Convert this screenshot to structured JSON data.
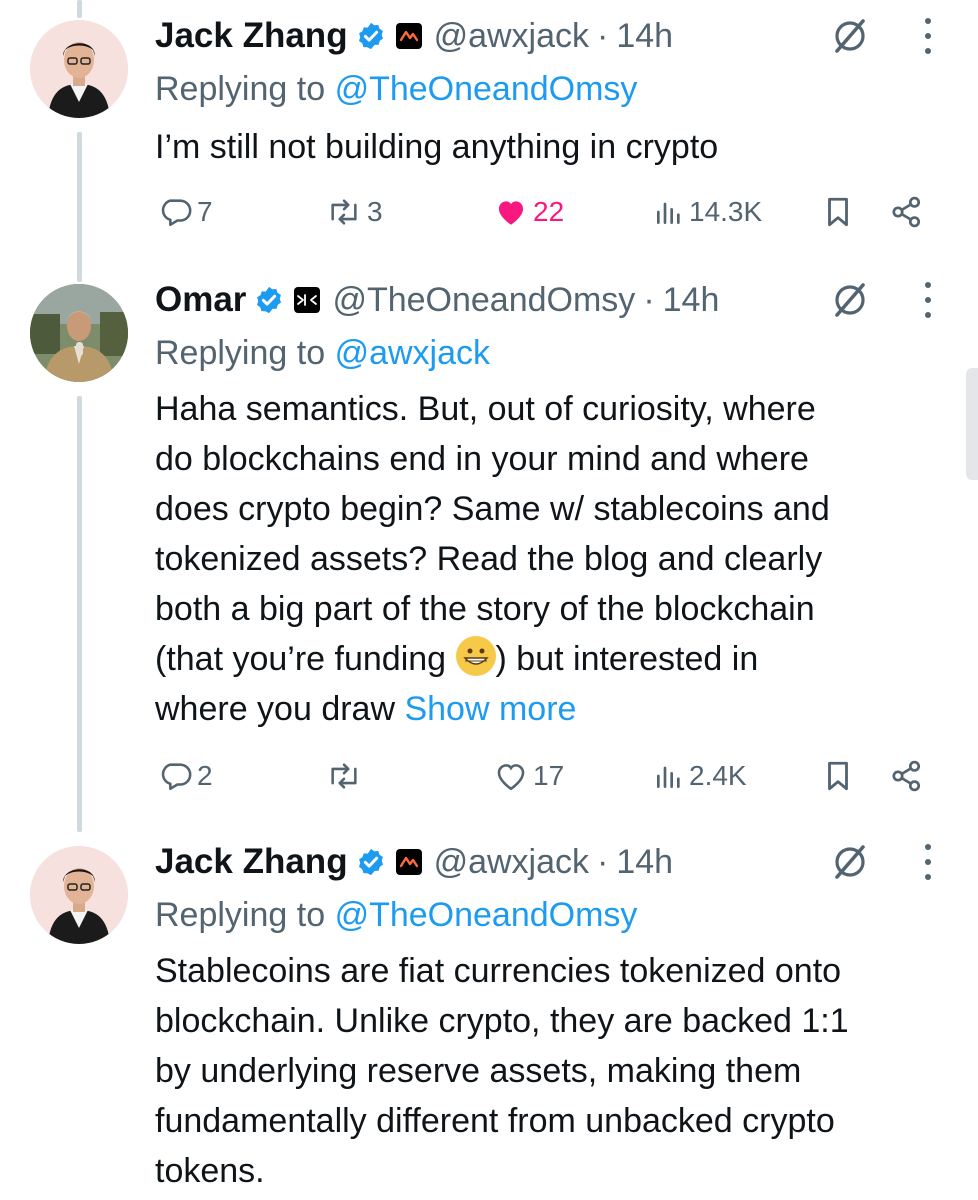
{
  "tweets": [
    {
      "name": "Jack Zhang",
      "handle": "@awxjack",
      "time": "14h",
      "replying_label": "Replying to",
      "replying_to": "@TheOneandOmsy",
      "text": "I’m still not building anything in crypto",
      "avatar_icon": "avatar-jack",
      "affiliate_icon": "airwallex-logo-icon",
      "stats": {
        "replies": "7",
        "reposts": "3",
        "likes": "22",
        "views": "14.3K",
        "liked": true
      }
    },
    {
      "name": "Omar",
      "handle": "@TheOneandOmsy",
      "time": "14h",
      "replying_label": "Replying to",
      "replying_to": "@awxjack",
      "text_lines": [
        "Haha semantics. But, out of curiosity, where",
        "do blockchains end in your mind and where",
        "does crypto begin? Same w/ stablecoins and",
        "tokenized assets? Read the blog and clearly",
        "both a big part of the story of the blockchain"
      ],
      "text_line6_before": "(that you’re funding ",
      "text_line6_after": ") but interested in",
      "text_line7": "where you draw ",
      "show_more": "Show more",
      "avatar_icon": "avatar-omar",
      "affiliate_icon": "affiliate-logo-icon",
      "stats": {
        "replies": "2",
        "reposts": "",
        "likes": "17",
        "views": "2.4K",
        "liked": false
      }
    },
    {
      "name": "Jack Zhang",
      "handle": "@awxjack",
      "time": "14h",
      "replying_label": "Replying to",
      "replying_to": "@TheOneandOmsy",
      "text_lines": [
        "Stablecoins are fiat currencies tokenized onto",
        "blockchain. Unlike crypto, they are backed 1:1",
        "by underlying reserve assets, making them",
        "fundamentally different from unbacked crypto",
        "tokens."
      ],
      "avatar_icon": "avatar-jack",
      "affiliate_icon": "airwallex-logo-icon"
    }
  ],
  "separator": "·",
  "colors": {
    "link": "#1d9bf0",
    "muted": "#536471",
    "like": "#f91880",
    "verified": "#1d9bf0"
  }
}
